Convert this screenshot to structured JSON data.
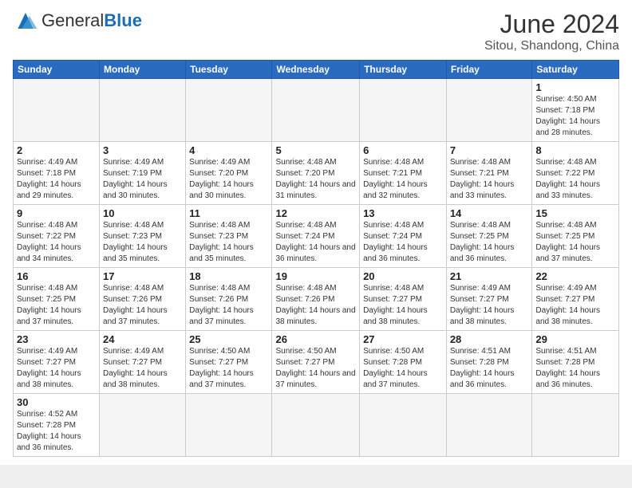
{
  "header": {
    "logo_general": "General",
    "logo_blue": "Blue",
    "month_title": "June 2024",
    "subtitle": "Sitou, Shandong, China"
  },
  "weekdays": [
    "Sunday",
    "Monday",
    "Tuesday",
    "Wednesday",
    "Thursday",
    "Friday",
    "Saturday"
  ],
  "weeks": [
    [
      {
        "day": "",
        "info": ""
      },
      {
        "day": "",
        "info": ""
      },
      {
        "day": "",
        "info": ""
      },
      {
        "day": "",
        "info": ""
      },
      {
        "day": "",
        "info": ""
      },
      {
        "day": "",
        "info": ""
      },
      {
        "day": "1",
        "info": "Sunrise: 4:50 AM\nSunset: 7:18 PM\nDaylight: 14 hours\nand 28 minutes."
      }
    ],
    [
      {
        "day": "2",
        "info": "Sunrise: 4:49 AM\nSunset: 7:18 PM\nDaylight: 14 hours\nand 29 minutes."
      },
      {
        "day": "3",
        "info": "Sunrise: 4:49 AM\nSunset: 7:19 PM\nDaylight: 14 hours\nand 30 minutes."
      },
      {
        "day": "4",
        "info": "Sunrise: 4:49 AM\nSunset: 7:20 PM\nDaylight: 14 hours\nand 30 minutes."
      },
      {
        "day": "5",
        "info": "Sunrise: 4:48 AM\nSunset: 7:20 PM\nDaylight: 14 hours\nand 31 minutes."
      },
      {
        "day": "6",
        "info": "Sunrise: 4:48 AM\nSunset: 7:21 PM\nDaylight: 14 hours\nand 32 minutes."
      },
      {
        "day": "7",
        "info": "Sunrise: 4:48 AM\nSunset: 7:21 PM\nDaylight: 14 hours\nand 33 minutes."
      },
      {
        "day": "8",
        "info": "Sunrise: 4:48 AM\nSunset: 7:22 PM\nDaylight: 14 hours\nand 33 minutes."
      }
    ],
    [
      {
        "day": "9",
        "info": "Sunrise: 4:48 AM\nSunset: 7:22 PM\nDaylight: 14 hours\nand 34 minutes."
      },
      {
        "day": "10",
        "info": "Sunrise: 4:48 AM\nSunset: 7:23 PM\nDaylight: 14 hours\nand 35 minutes."
      },
      {
        "day": "11",
        "info": "Sunrise: 4:48 AM\nSunset: 7:23 PM\nDaylight: 14 hours\nand 35 minutes."
      },
      {
        "day": "12",
        "info": "Sunrise: 4:48 AM\nSunset: 7:24 PM\nDaylight: 14 hours\nand 36 minutes."
      },
      {
        "day": "13",
        "info": "Sunrise: 4:48 AM\nSunset: 7:24 PM\nDaylight: 14 hours\nand 36 minutes."
      },
      {
        "day": "14",
        "info": "Sunrise: 4:48 AM\nSunset: 7:25 PM\nDaylight: 14 hours\nand 36 minutes."
      },
      {
        "day": "15",
        "info": "Sunrise: 4:48 AM\nSunset: 7:25 PM\nDaylight: 14 hours\nand 37 minutes."
      }
    ],
    [
      {
        "day": "16",
        "info": "Sunrise: 4:48 AM\nSunset: 7:25 PM\nDaylight: 14 hours\nand 37 minutes."
      },
      {
        "day": "17",
        "info": "Sunrise: 4:48 AM\nSunset: 7:26 PM\nDaylight: 14 hours\nand 37 minutes."
      },
      {
        "day": "18",
        "info": "Sunrise: 4:48 AM\nSunset: 7:26 PM\nDaylight: 14 hours\nand 37 minutes."
      },
      {
        "day": "19",
        "info": "Sunrise: 4:48 AM\nSunset: 7:26 PM\nDaylight: 14 hours\nand 38 minutes."
      },
      {
        "day": "20",
        "info": "Sunrise: 4:48 AM\nSunset: 7:27 PM\nDaylight: 14 hours\nand 38 minutes."
      },
      {
        "day": "21",
        "info": "Sunrise: 4:49 AM\nSunset: 7:27 PM\nDaylight: 14 hours\nand 38 minutes."
      },
      {
        "day": "22",
        "info": "Sunrise: 4:49 AM\nSunset: 7:27 PM\nDaylight: 14 hours\nand 38 minutes."
      }
    ],
    [
      {
        "day": "23",
        "info": "Sunrise: 4:49 AM\nSunset: 7:27 PM\nDaylight: 14 hours\nand 38 minutes."
      },
      {
        "day": "24",
        "info": "Sunrise: 4:49 AM\nSunset: 7:27 PM\nDaylight: 14 hours\nand 38 minutes."
      },
      {
        "day": "25",
        "info": "Sunrise: 4:50 AM\nSunset: 7:27 PM\nDaylight: 14 hours\nand 37 minutes."
      },
      {
        "day": "26",
        "info": "Sunrise: 4:50 AM\nSunset: 7:27 PM\nDaylight: 14 hours\nand 37 minutes."
      },
      {
        "day": "27",
        "info": "Sunrise: 4:50 AM\nSunset: 7:28 PM\nDaylight: 14 hours\nand 37 minutes."
      },
      {
        "day": "28",
        "info": "Sunrise: 4:51 AM\nSunset: 7:28 PM\nDaylight: 14 hours\nand 36 minutes."
      },
      {
        "day": "29",
        "info": "Sunrise: 4:51 AM\nSunset: 7:28 PM\nDaylight: 14 hours\nand 36 minutes."
      }
    ],
    [
      {
        "day": "30",
        "info": "Sunrise: 4:52 AM\nSunset: 7:28 PM\nDaylight: 14 hours\nand 36 minutes."
      },
      {
        "day": "",
        "info": ""
      },
      {
        "day": "",
        "info": ""
      },
      {
        "day": "",
        "info": ""
      },
      {
        "day": "",
        "info": ""
      },
      {
        "day": "",
        "info": ""
      },
      {
        "day": "",
        "info": ""
      }
    ]
  ]
}
